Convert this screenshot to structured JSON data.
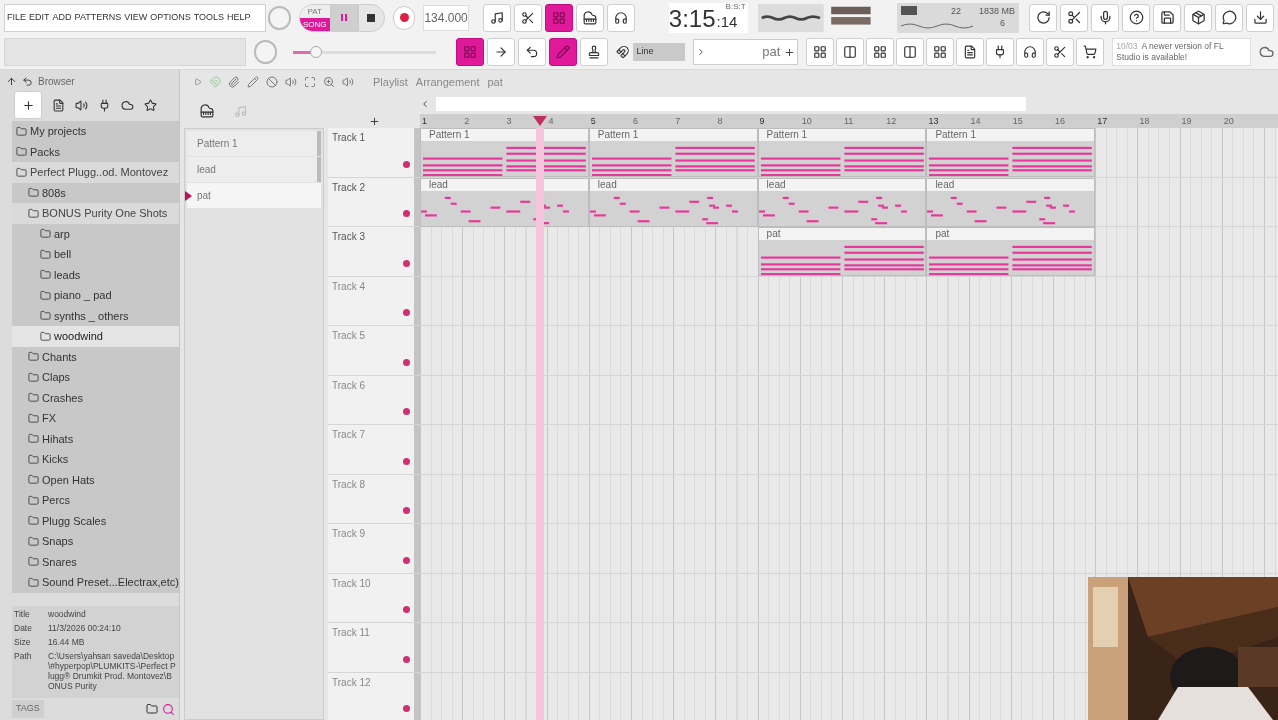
{
  "menu": [
    "FILE",
    "EDIT",
    "ADD",
    "PATTERNS",
    "VIEW",
    "OPTIONS",
    "TOOLS",
    "HELP"
  ],
  "transport": {
    "pat_label": "PAT",
    "song_label": "SONG",
    "song_selected": true,
    "paused": true,
    "tempo": "134.000"
  },
  "tempo_slider": {
    "level": 0.15
  },
  "time": {
    "main": "3:15",
    "sub": ":14",
    "format": "B:S:T"
  },
  "monitor": {
    "cpu": "22",
    "memory": "1838 MB",
    "polyphony": "6"
  },
  "tool_toggles_top": [
    {
      "on": false
    },
    {
      "on": false
    },
    {
      "on": true
    },
    {
      "on": false
    },
    {
      "on": false
    }
  ],
  "tool_toggles_bottom": [
    {
      "on": true
    },
    {
      "on": false
    },
    {
      "on": false
    },
    {
      "on": true
    },
    {
      "on": false
    }
  ],
  "snap": "Line",
  "pattern_selector": "pat",
  "hint": {
    "date": "10/03",
    "text": "A newer version of FL Studio is available!"
  },
  "browser": {
    "title": "Browser",
    "items": [
      {
        "label": "My projects",
        "expanded": false,
        "selected": false
      },
      {
        "label": "Packs",
        "expanded": false,
        "selected": false
      },
      {
        "label": "Perfect Plugg..od. Montovez",
        "expanded": true,
        "selected": false,
        "children": [
          {
            "label": "808s",
            "expanded": false,
            "selected": false
          },
          {
            "label": "BONUS Purity One Shots",
            "expanded": true,
            "selected": false,
            "children": [
              {
                "label": "arp",
                "expanded": false,
                "selected": false
              },
              {
                "label": "bell",
                "expanded": false,
                "selected": false
              },
              {
                "label": "leads",
                "expanded": false,
                "selected": false
              },
              {
                "label": "piano _ pad",
                "expanded": false,
                "selected": false
              },
              {
                "label": "synths _ others",
                "expanded": false,
                "selected": false
              },
              {
                "label": "woodwind",
                "expanded": false,
                "selected": true
              }
            ]
          },
          {
            "label": "Chants",
            "expanded": false,
            "selected": false
          },
          {
            "label": "Claps",
            "expanded": false,
            "selected": false
          },
          {
            "label": "Crashes",
            "expanded": false,
            "selected": false
          },
          {
            "label": "FX",
            "expanded": false,
            "selected": false
          },
          {
            "label": "Hihats",
            "expanded": false,
            "selected": false
          },
          {
            "label": "Kicks",
            "expanded": false,
            "selected": false
          },
          {
            "label": "Open Hats",
            "expanded": false,
            "selected": false
          },
          {
            "label": "Percs",
            "expanded": false,
            "selected": false
          },
          {
            "label": "Plugg Scales",
            "expanded": false,
            "selected": false
          },
          {
            "label": "Snaps",
            "expanded": false,
            "selected": false
          },
          {
            "label": "Snares",
            "expanded": false,
            "selected": false
          },
          {
            "label": "Sound Preset...Electrax,etc)",
            "expanded": false,
            "selected": false
          }
        ]
      }
    ],
    "info": [
      {
        "key": "Title",
        "value": "woodwind"
      },
      {
        "key": "Date",
        "value": "11/3/2026 00:24:10"
      },
      {
        "key": "Size",
        "value": "16.44 MB"
      },
      {
        "key": "Path",
        "value": "C:\\Users\\yahsan saveda\\Desktop\\#hyperpop\\PLUMKITS-\\Perfect Plugg® Drumkit Prod. Montovez\\BONUS Purity"
      }
    ],
    "tags_label": "TAGS"
  },
  "playlist": {
    "breadcrumb": [
      "Playlist",
      "Arrangement",
      "pat"
    ],
    "patterns": [
      {
        "name": "Pattern 1",
        "selected": false
      },
      {
        "name": "lead",
        "selected": false
      },
      {
        "name": "pat",
        "selected": true
      }
    ],
    "ruler": [
      "1",
      "2",
      "3",
      "4",
      "5",
      "6",
      "7",
      "8",
      "9",
      "10",
      "11",
      "12",
      "13",
      "14",
      "15",
      "16",
      "17",
      "18",
      "19",
      "20"
    ],
    "tracks": [
      {
        "name": "Track 1",
        "segments": [
          {
            "label": "Pattern 1",
            "kind": "chords"
          },
          {
            "label": "Pattern 1",
            "kind": "chords"
          },
          {
            "label": "Pattern 1",
            "kind": "chords"
          },
          {
            "label": "Pattern 1",
            "kind": "chords"
          }
        ]
      },
      {
        "name": "Track 2",
        "segments": [
          {
            "label": "lead",
            "kind": "melody"
          },
          {
            "label": "lead",
            "kind": "melody"
          },
          {
            "label": "lead",
            "kind": "melody"
          },
          {
            "label": "lead",
            "kind": "melody"
          }
        ]
      },
      {
        "name": "Track 3",
        "segments": [
          {
            "kind": "empty"
          },
          {
            "kind": "empty"
          },
          {
            "label": "pat",
            "kind": "chords"
          },
          {
            "label": "pat",
            "kind": "chords"
          }
        ]
      },
      {
        "name": "Track 4"
      },
      {
        "name": "Track 5"
      },
      {
        "name": "Track 6"
      },
      {
        "name": "Track 7"
      },
      {
        "name": "Track 8"
      },
      {
        "name": "Track 9"
      },
      {
        "name": "Track 10"
      },
      {
        "name": "Track 11"
      },
      {
        "name": "Track 12"
      }
    ]
  }
}
